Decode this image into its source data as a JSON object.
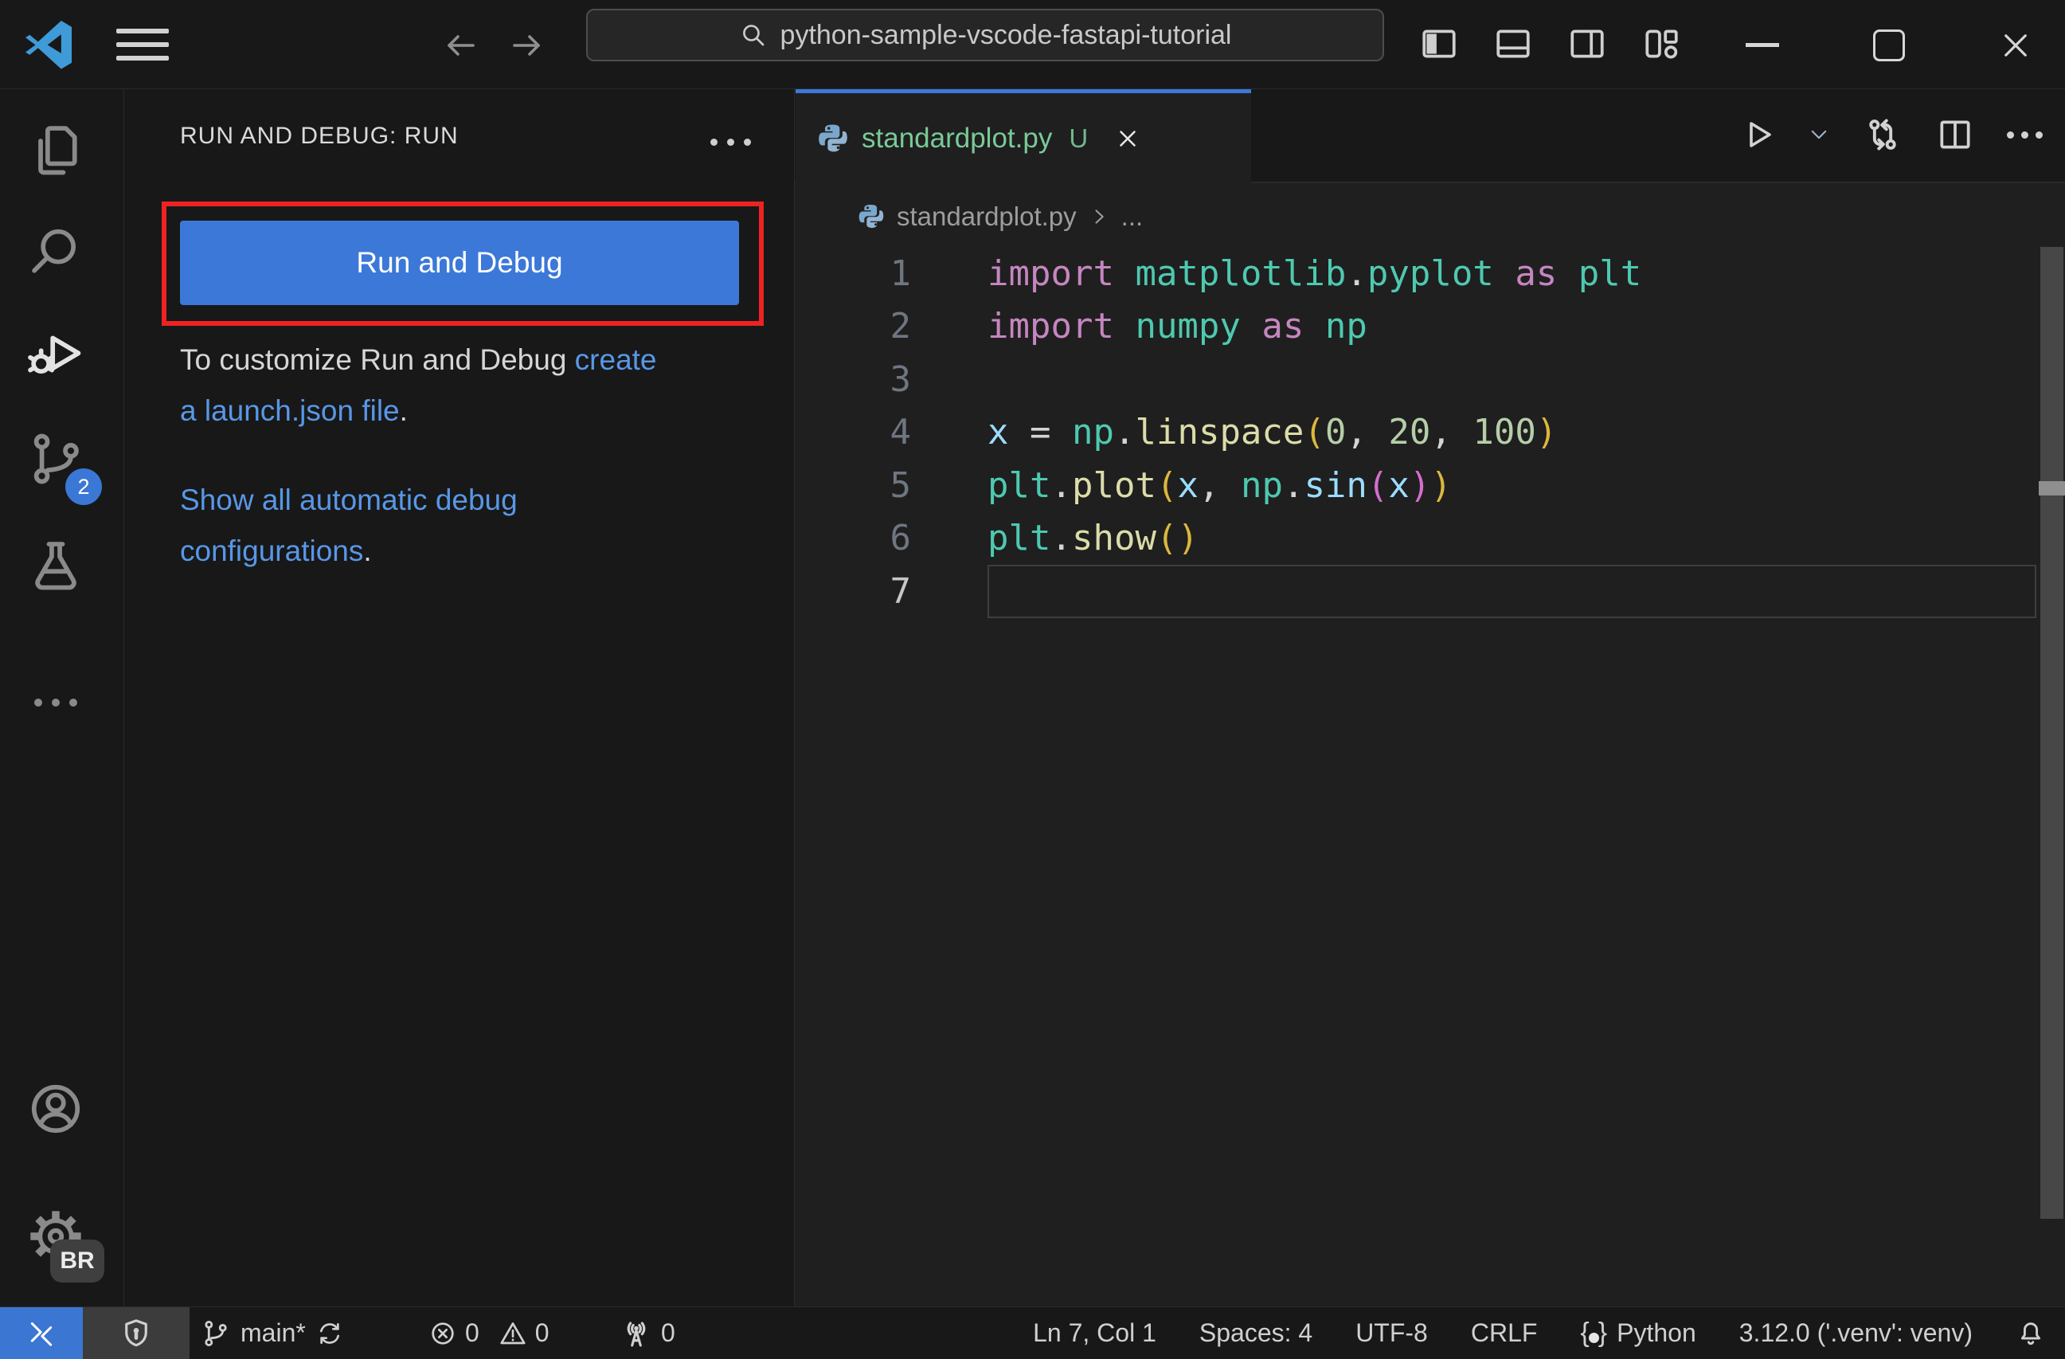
{
  "titlebar": {
    "search_text": "python-sample-vscode-fastapi-tutorial"
  },
  "activity_bar": {
    "scm_badge": "2",
    "gear_badge": "BR"
  },
  "sidebar": {
    "title": "RUN AND DEBUG: RUN",
    "run_button": "Run and Debug",
    "hint_prefix": "To customize Run and Debug ",
    "hint_link": "create a launch.json file",
    "hint_suffix": ".",
    "auto_link": "Show all automatic debug configurations",
    "auto_suffix": "."
  },
  "editor": {
    "tab_label": "standardplot.py",
    "tab_badge": "U",
    "breadcrumb_file": "standardplot.py",
    "breadcrumb_more": "...",
    "code_lines": [
      {
        "num": "1",
        "tokens": [
          [
            "import",
            "kw"
          ],
          [
            " ",
            "pln"
          ],
          [
            "matplotlib",
            "typ"
          ],
          [
            ".",
            "pln"
          ],
          [
            "pyplot",
            "typ"
          ],
          [
            " ",
            "pln"
          ],
          [
            "as",
            "kw"
          ],
          [
            " ",
            "pln"
          ],
          [
            "plt",
            "typ"
          ]
        ]
      },
      {
        "num": "2",
        "tokens": [
          [
            "import",
            "kw"
          ],
          [
            " ",
            "pln"
          ],
          [
            "numpy",
            "typ"
          ],
          [
            " ",
            "pln"
          ],
          [
            "as",
            "kw"
          ],
          [
            " ",
            "pln"
          ],
          [
            "np",
            "typ"
          ]
        ]
      },
      {
        "num": "3",
        "tokens": []
      },
      {
        "num": "4",
        "tokens": [
          [
            "x",
            "var"
          ],
          [
            " ",
            "pln"
          ],
          [
            "=",
            "op"
          ],
          [
            " ",
            "pln"
          ],
          [
            "np",
            "typ"
          ],
          [
            ".",
            "pln"
          ],
          [
            "linspace",
            "fn"
          ],
          [
            "(",
            "b1"
          ],
          [
            "0",
            "num"
          ],
          [
            ",",
            "pln"
          ],
          [
            " ",
            "pln"
          ],
          [
            "20",
            "num"
          ],
          [
            ",",
            "pln"
          ],
          [
            " ",
            "pln"
          ],
          [
            "100",
            "num"
          ],
          [
            ")",
            "b1"
          ]
        ]
      },
      {
        "num": "5",
        "tokens": [
          [
            "plt",
            "typ"
          ],
          [
            ".",
            "pln"
          ],
          [
            "plot",
            "fn"
          ],
          [
            "(",
            "b1"
          ],
          [
            "x",
            "var"
          ],
          [
            ",",
            "pln"
          ],
          [
            " ",
            "pln"
          ],
          [
            "np",
            "typ"
          ],
          [
            ".",
            "pln"
          ],
          [
            "sin",
            "var"
          ],
          [
            "(",
            "b2"
          ],
          [
            "x",
            "var"
          ],
          [
            ")",
            "b2"
          ],
          [
            ")",
            "b1"
          ]
        ]
      },
      {
        "num": "6",
        "tokens": [
          [
            "plt",
            "typ"
          ],
          [
            ".",
            "pln"
          ],
          [
            "show",
            "fn"
          ],
          [
            "(",
            "b1"
          ],
          [
            ")",
            "b1"
          ]
        ]
      },
      {
        "num": "7",
        "tokens": [],
        "current": true
      }
    ]
  },
  "status_bar": {
    "branch": "main*",
    "errors": "0",
    "warnings": "0",
    "ports": "0",
    "cursor": "Ln 7, Col 1",
    "indent": "Spaces: 4",
    "encoding": "UTF-8",
    "eol": "CRLF",
    "language": "Python",
    "interpreter": "3.12.0 ('.venv': venv)"
  },
  "colors": {
    "chrome_bg": "#181818",
    "editor_bg": "#1f1f1f",
    "accent_blue": "#3c78d8",
    "remote_blue": "#3b76d3",
    "badge_blue": "#3b78d6",
    "link_blue": "#5897e7",
    "untracked_green": "#79ca97",
    "annotation_red": "#ee2222",
    "syntax": {
      "keyword": "#C586C0",
      "type": "#4EC9B0",
      "function": "#DCDCAA",
      "variable": "#9CDCFE",
      "number": "#B5CEA8",
      "punctuation": "#d4d4d4",
      "bracket_level1": "#dcb73d",
      "bracket_level2": "#d46ecd"
    }
  },
  "icons": {
    "vscode-logo": "vscode-mark",
    "menu-icon": "hamburger",
    "back-icon": "arrow-left",
    "forward-icon": "arrow-right",
    "search-icon": "magnifier",
    "layout-sidebar-left-icon": "panel-left-filled",
    "layout-panel-icon": "panel-bottom",
    "layout-sidebar-right-icon": "panel-right",
    "customize-layout-icon": "shapes-grid",
    "minimize-icon": "dash",
    "maximize-icon": "square-outline",
    "close-icon": "x",
    "explorer-icon": "stacked-files",
    "search-view-icon": "magnifier",
    "run-debug-icon": "play-with-bug",
    "source-control-icon": "git-nodes",
    "testing-icon": "beaker",
    "more-views-icon": "ellipsis",
    "account-icon": "person-circle",
    "settings-icon": "gear",
    "python-file-icon": "python-snakes",
    "run-icon": "play-outline",
    "run-dropdown-icon": "chevron-down",
    "open-changes-icon": "circular-swap-arrows",
    "split-editor-icon": "split-square",
    "editor-more-icon": "ellipsis",
    "remote-icon": "angle-brackets",
    "workspace-trust-icon": "shield-keyhole",
    "branch-icon": "git-branch",
    "sync-icon": "circular-refresh",
    "error-icon": "circle-x",
    "warning-icon": "triangle-exclamation",
    "ports-icon": "radio-tower",
    "language-icon": "curly-braces-dot",
    "bell-icon": "bell"
  }
}
